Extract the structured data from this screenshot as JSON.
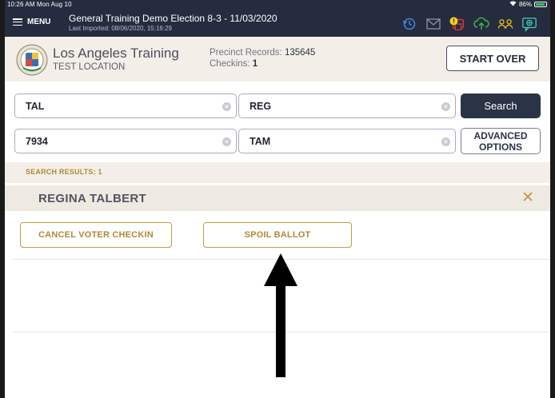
{
  "status_bar": {
    "time": "10:26 AM  Mon Aug 10",
    "battery": "86%"
  },
  "topbar": {
    "menu_label": "MENU",
    "title": "General Training  Demo Election 8-3 - 11/03/2020",
    "subtitle": "Last Imported: 08/06/2020, 15:16:29",
    "icons": [
      "history-icon",
      "mail-icon",
      "printer-alert-icon",
      "cloud-upload-icon",
      "users-icon",
      "chat-icon"
    ]
  },
  "header": {
    "org_name": "Los Angeles Training",
    "location": "TEST LOCATION",
    "precinct_label": "Precinct Records: ",
    "precinct_value": "135645",
    "checkins_label": "Checkins: ",
    "checkins_value": "1",
    "start_over": "START OVER"
  },
  "search": {
    "last_name": "TAL",
    "first_name": "REG",
    "number": "7934",
    "field4": "TAM",
    "clear_glyph": "×",
    "search_label": "Search",
    "advanced_line1": "ADVANCED",
    "advanced_line2": "OPTIONS"
  },
  "results": {
    "label": "SEARCH RESULTS: 1",
    "voter_name": "REGINA TALBERT",
    "close_glyph": "✕",
    "cancel_checkin": "CANCEL VOTER CHECKIN",
    "spoil_ballot": "SPOIL BALLOT"
  },
  "colors": {
    "topbar": "#262c3f",
    "band": "#f3efe8",
    "accent_gold": "#c49a3e",
    "search_button": "#2b3346"
  }
}
